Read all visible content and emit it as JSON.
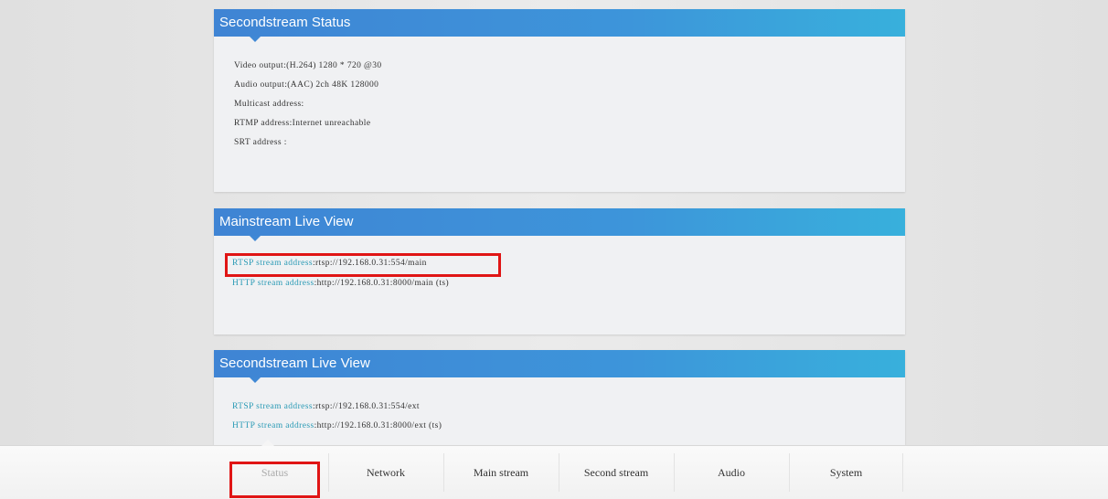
{
  "panels": {
    "secondstream_status": {
      "title": "Secondstream Status",
      "lines": [
        "Video output:(H.264) 1280 * 720 @30",
        "Audio output:(AAC) 2ch 48K 128000",
        "Multicast address:",
        "RTMP address:Internet unreachable",
        "SRT address :"
      ]
    },
    "mainstream_live_view": {
      "title": "Mainstream Live View",
      "rtsp_label": "RTSP stream address",
      "rtsp_value": ":rtsp://192.168.0.31:554/main",
      "http_label": "HTTP stream address",
      "http_value": ":http://192.168.0.31:8000/main (ts)"
    },
    "secondstream_live_view": {
      "title": "Secondstream Live View",
      "rtsp_label": "RTSP stream address",
      "rtsp_value": ":rtsp://192.168.0.31:554/ext",
      "http_label": "HTTP stream address",
      "http_value": ":http://192.168.0.31:8000/ext (ts)"
    }
  },
  "nav": {
    "items": [
      "Status",
      "Network",
      "Main stream",
      "Second stream",
      "Audio",
      "System"
    ],
    "active": "Status"
  },
  "colors": {
    "header_blue": "#3f84d4",
    "header_cyan": "#38b0dc",
    "link_teal": "#2a9ab5",
    "highlight_red": "#e01515"
  }
}
